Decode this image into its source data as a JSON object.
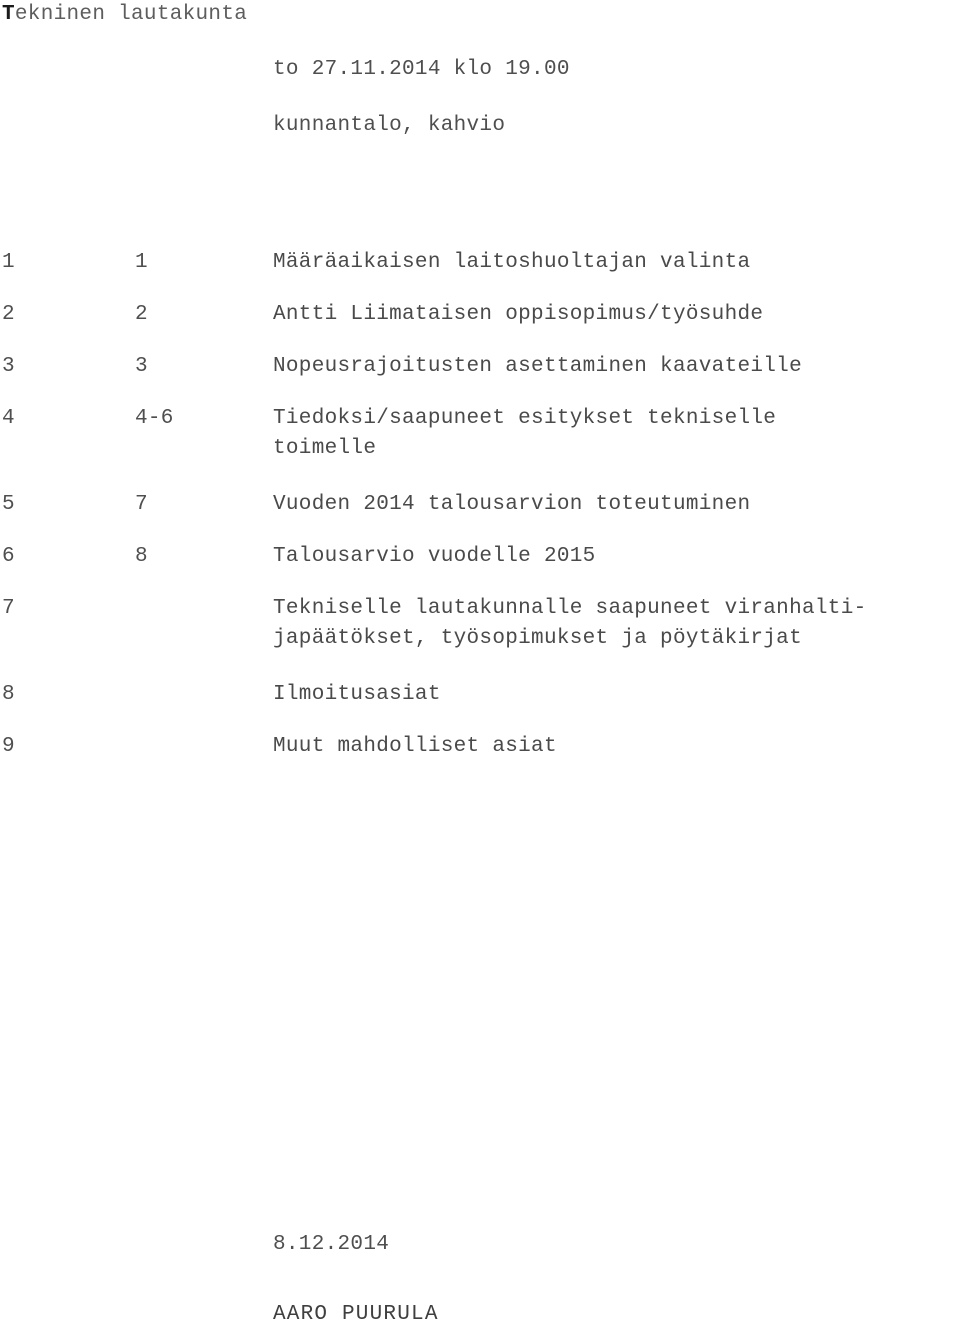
{
  "document": {
    "title_first_letter": "T",
    "title_rest": "ekninen lautakunta",
    "title_full": "Tekninen lautakunta"
  },
  "meta": {
    "datetime": "to 27.11.2014 klo 19.00",
    "location": "kunnantalo, kahvio"
  },
  "agenda": {
    "rows": [
      {
        "index": "1",
        "ref": "1",
        "line1": "Määräaikaisen laitoshuoltajan valinta",
        "line2": ""
      },
      {
        "index": "2",
        "ref": "2",
        "line1": "Antti Liimataisen oppisopimus/työsuhde",
        "line2": ""
      },
      {
        "index": "3",
        "ref": "3",
        "line1": "Nopeusrajoitusten asettaminen kaavateille",
        "line2": ""
      },
      {
        "index": "4",
        "ref": "4-6",
        "line1": "Tiedoksi/saapuneet esitykset tekniselle",
        "line2": "toimelle"
      },
      {
        "index": "5",
        "ref": "7",
        "line1": "Vuoden 2014 talousarvion toteutuminen",
        "line2": ""
      },
      {
        "index": "6",
        "ref": "8",
        "line1": "Talousarvio vuodelle 2015",
        "line2": ""
      },
      {
        "index": "7",
        "ref": "",
        "line1": "Tekniselle lautakunnalle saapuneet viranhalti-",
        "line2": "japäätökset, työsopimukset ja pöytäkirjat"
      },
      {
        "index": "8",
        "ref": "",
        "line1": "Ilmoitusasiat",
        "line2": ""
      },
      {
        "index": "9",
        "ref": "",
        "line1": "Muut mahdolliset asiat",
        "line2": ""
      }
    ]
  },
  "footer": {
    "date": "8.12.2014",
    "signature": "AARO PUURULA"
  },
  "colors": {
    "page_background": "#ffffff",
    "body_text": "#4a4a4a",
    "title_cap": "#1b1b1b",
    "title_rest": "#5d5d5d"
  }
}
